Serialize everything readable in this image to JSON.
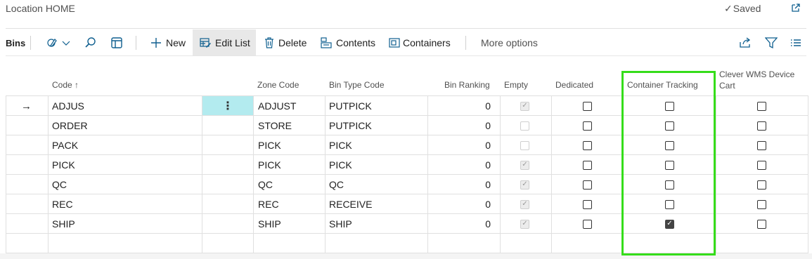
{
  "page": {
    "title": "Location HOME",
    "saved_label": "Saved"
  },
  "actions": {
    "tab": "Bins",
    "new": "New",
    "edit_list": "Edit List",
    "delete": "Delete",
    "contents": "Contents",
    "containers": "Containers",
    "more": "More options"
  },
  "table": {
    "headers": {
      "code": "Code ↑",
      "zone_code": "Zone Code",
      "bin_type_code": "Bin Type Code",
      "bin_ranking": "Bin Ranking",
      "empty": "Empty",
      "dedicated": "Dedicated",
      "container_tracking": "Container Tracking",
      "clever_wms_line1": "Clever WMS Device",
      "clever_wms_line2": "Cart"
    },
    "rows": [
      {
        "code": "ADJUS",
        "zone": "ADJUST",
        "bin_type": "PUTPICK",
        "ranking": "0",
        "empty": true,
        "dedicated": false,
        "container_tracking": false,
        "device_cart": false
      },
      {
        "code": "ORDER",
        "zone": "STORE",
        "bin_type": "PUTPICK",
        "ranking": "0",
        "empty": false,
        "dedicated": false,
        "container_tracking": false,
        "device_cart": false
      },
      {
        "code": "PACK",
        "zone": "PICK",
        "bin_type": "PICK",
        "ranking": "0",
        "empty": false,
        "dedicated": false,
        "container_tracking": false,
        "device_cart": false
      },
      {
        "code": "PICK",
        "zone": "PICK",
        "bin_type": "PICK",
        "ranking": "0",
        "empty": true,
        "dedicated": false,
        "container_tracking": false,
        "device_cart": false
      },
      {
        "code": "QC",
        "zone": "QC",
        "bin_type": "QC",
        "ranking": "0",
        "empty": true,
        "dedicated": false,
        "container_tracking": false,
        "device_cart": false
      },
      {
        "code": "REC",
        "zone": "REC",
        "bin_type": "RECEIVE",
        "ranking": "0",
        "empty": true,
        "dedicated": false,
        "container_tracking": false,
        "device_cart": false
      },
      {
        "code": "SHIP",
        "zone": "SHIP",
        "bin_type": "SHIP",
        "ranking": "0",
        "empty": true,
        "dedicated": false,
        "container_tracking": true,
        "device_cart": false
      }
    ]
  },
  "colors": {
    "highlight": "#35dd1a",
    "selected_cell": "#b3ebef",
    "accent_icon": "#0f5f8f"
  }
}
